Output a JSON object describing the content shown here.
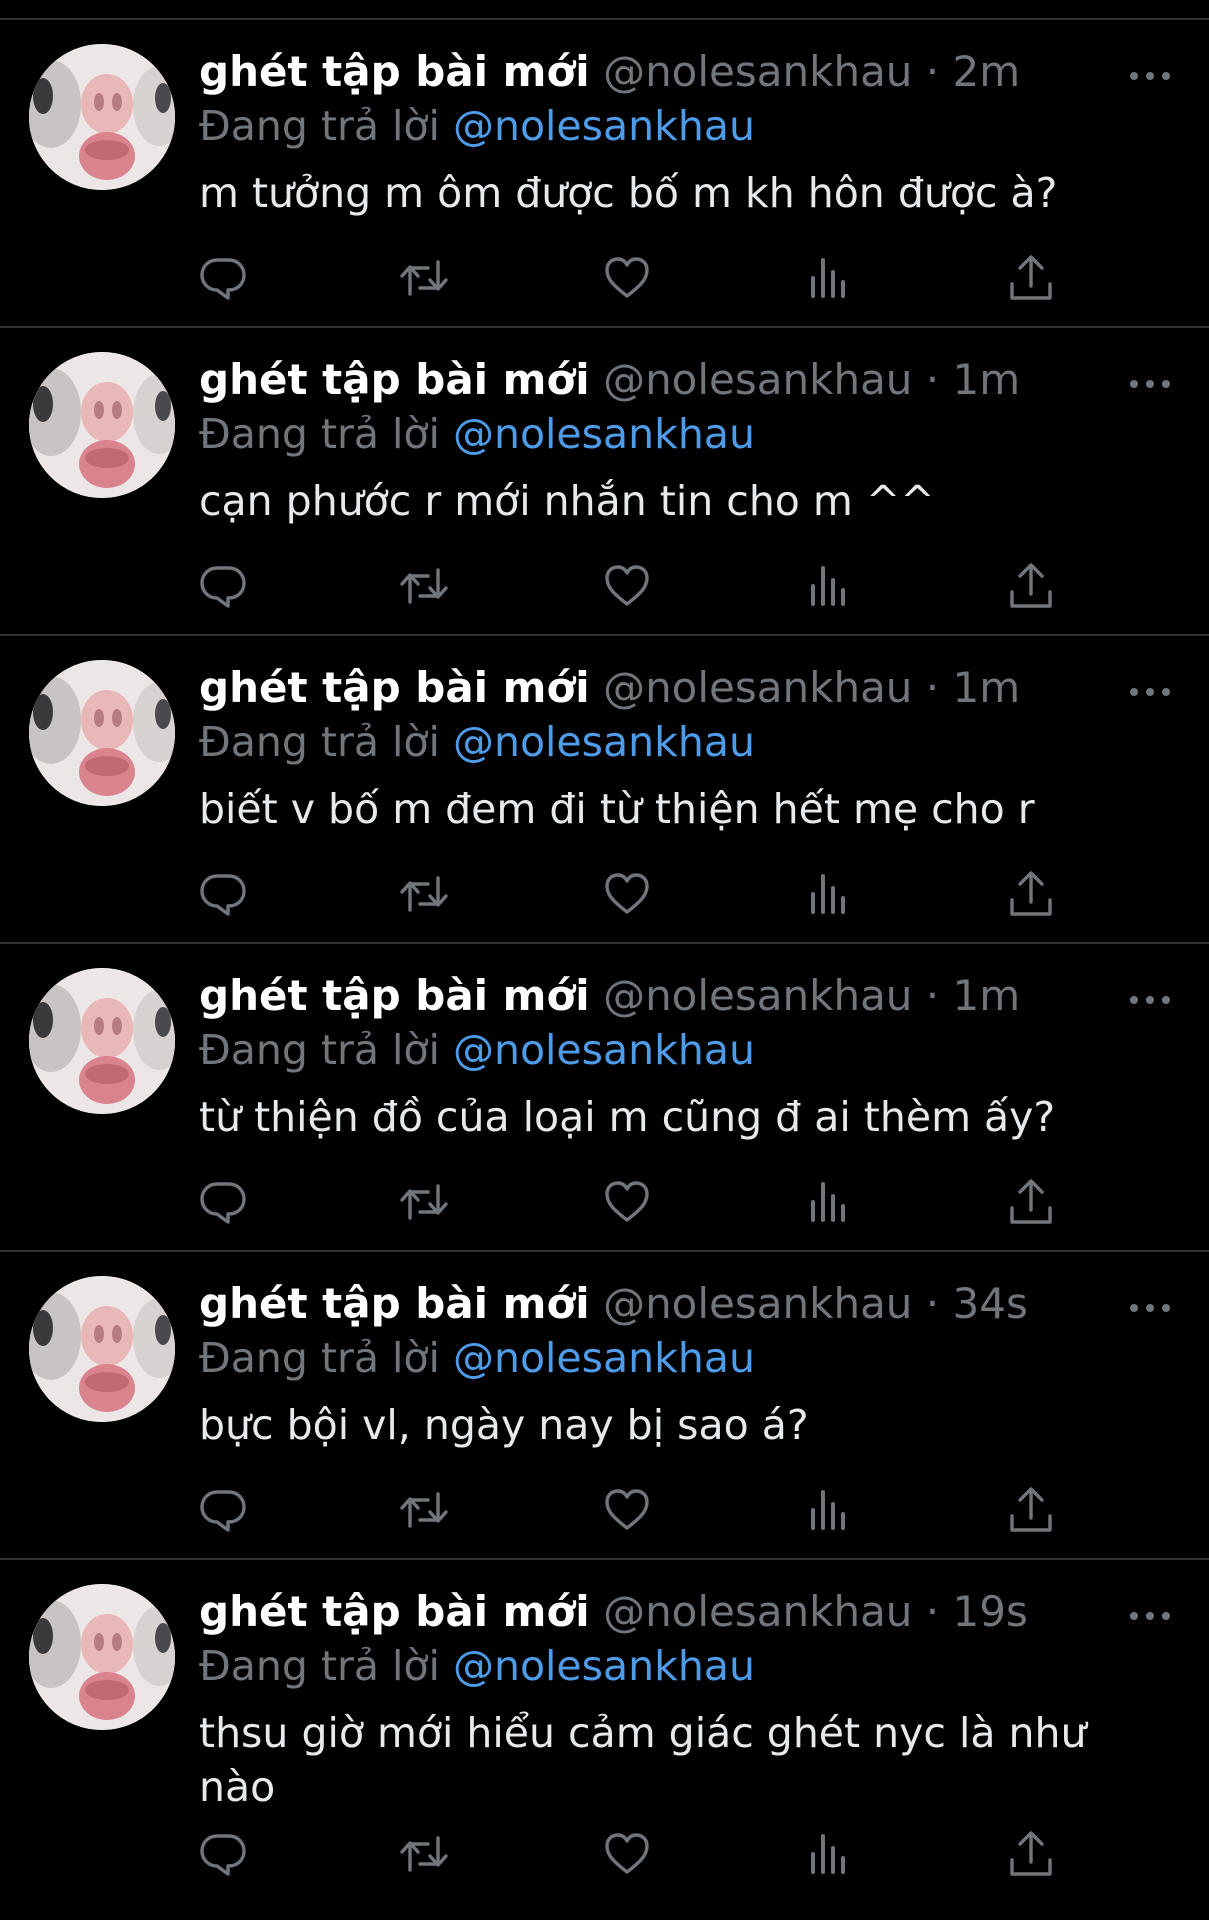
{
  "colors": {
    "background": "#000000",
    "divider": "#2f3336",
    "name": "#ffffff",
    "secondary": "#71767b",
    "mention": "#4e9be8",
    "text": "#e7e9ea"
  },
  "icons": {
    "more": "more-horizontal-icon",
    "reply": "reply-icon",
    "retweet": "retweet-icon",
    "like": "heart-icon",
    "views": "views-icon",
    "share": "share-icon"
  },
  "tweets": [
    {
      "display_name": "ghét tập bài mới",
      "handle": "@nolesankhau",
      "separator": "·",
      "time": "2m",
      "reply_prefix": "Đang trả lời",
      "reply_to": "@nolesankhau",
      "text": "m tưởng m ôm được bố m kh hôn được à?"
    },
    {
      "display_name": "ghét tập bài mới",
      "handle": "@nolesankhau",
      "separator": "·",
      "time": "1m",
      "reply_prefix": "Đang trả lời",
      "reply_to": "@nolesankhau",
      "text": "cạn phước r mới nhắn tin cho m ^^"
    },
    {
      "display_name": "ghét tập bài mới",
      "handle": "@nolesankhau",
      "separator": "·",
      "time": "1m",
      "reply_prefix": "Đang trả lời",
      "reply_to": "@nolesankhau",
      "text": "biết v bố m đem đi từ thiện hết mẹ cho r"
    },
    {
      "display_name": "ghét tập bài mới",
      "handle": "@nolesankhau",
      "separator": "·",
      "time": "1m",
      "reply_prefix": "Đang trả lời",
      "reply_to": "@nolesankhau",
      "text": "từ thiện đồ của loại m cũng đ ai thèm ấy?"
    },
    {
      "display_name": "ghét tập bài mới",
      "handle": "@nolesankhau",
      "separator": "·",
      "time": "34s",
      "reply_prefix": "Đang trả lời",
      "reply_to": "@nolesankhau",
      "text": "bực bội vl, ngày nay bị sao á?"
    },
    {
      "display_name": "ghét tập bài mới",
      "handle": "@nolesankhau",
      "separator": "·",
      "time": "19s",
      "reply_prefix": "Đang trả lời",
      "reply_to": "@nolesankhau",
      "text": "thsu giờ mới hiểu cảm giác ghét nyc là như nào"
    }
  ]
}
